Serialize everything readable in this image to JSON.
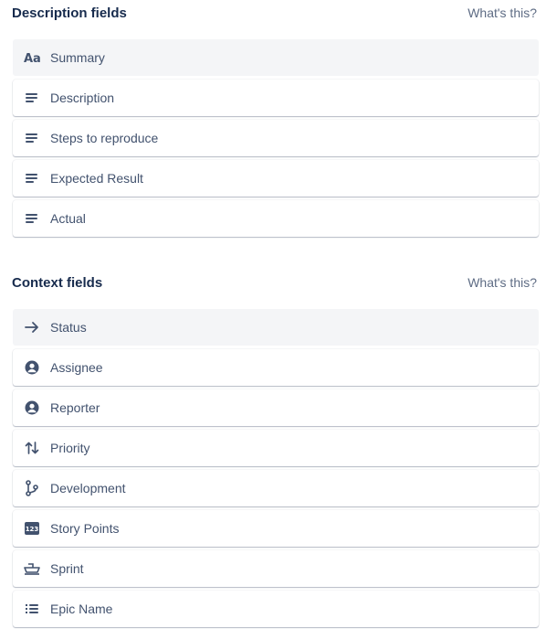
{
  "description_section": {
    "title": "Description fields",
    "help_link": "What's this?",
    "fields": [
      {
        "label": "Summary",
        "icon": "text-aa-icon"
      },
      {
        "label": "Description",
        "icon": "paragraph-icon"
      },
      {
        "label": "Steps to reproduce",
        "icon": "paragraph-icon"
      },
      {
        "label": "Expected Result",
        "icon": "paragraph-icon"
      },
      {
        "label": "Actual",
        "icon": "paragraph-icon"
      }
    ]
  },
  "context_section": {
    "title": "Context fields",
    "help_link": "What's this?",
    "fields": [
      {
        "label": "Status",
        "icon": "arrow-right-icon"
      },
      {
        "label": "Assignee",
        "icon": "user-avatar-icon"
      },
      {
        "label": "Reporter",
        "icon": "user-avatar-icon"
      },
      {
        "label": "Priority",
        "icon": "arrows-up-down-icon"
      },
      {
        "label": "Development",
        "icon": "branch-icon"
      },
      {
        "label": "Story Points",
        "icon": "number-123-icon",
        "icon_text": "123"
      },
      {
        "label": "Sprint",
        "icon": "ship-icon"
      },
      {
        "label": "Epic Name",
        "icon": "bulleted-list-icon"
      }
    ]
  },
  "colors": {
    "text": "#172b4d",
    "muted": "#5e6c84",
    "icon": "#42526e",
    "system_row_bg": "#f4f5f7"
  }
}
